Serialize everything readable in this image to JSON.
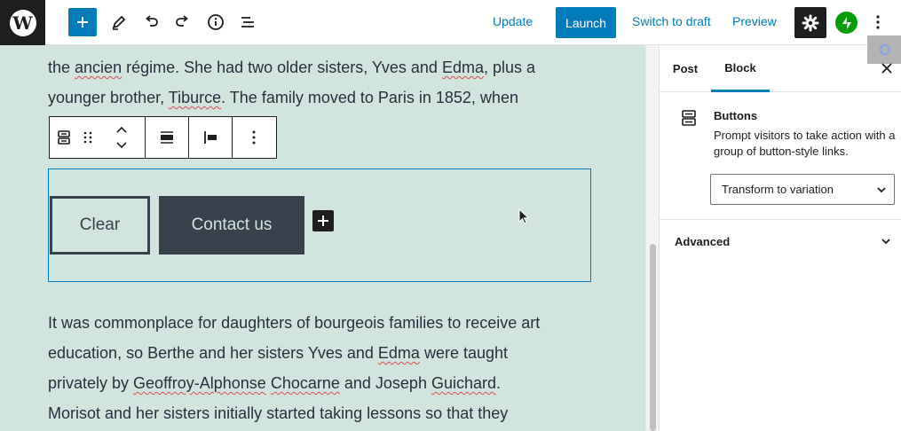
{
  "toolbar": {
    "update_label": "Update",
    "launch_label": "Launch",
    "switch_draft_label": "Switch to draft",
    "preview_label": "Preview",
    "logo_letter": "W"
  },
  "content": {
    "para1": [
      [
        {
          "t": "the "
        },
        {
          "t": "ancien",
          "s": true
        },
        {
          "t": " régime. She had two older sisters, Yves and "
        },
        {
          "t": "Edma",
          "s": true
        },
        {
          "t": ", plus a"
        }
      ],
      [
        {
          "t": "younger brother, "
        },
        {
          "t": "Tiburce",
          "s": true
        },
        {
          "t": ". The family moved to Paris in 1852, when"
        }
      ]
    ],
    "para2": [
      [
        {
          "t": "It was commonplace for daughters of bourgeois families to receive art"
        }
      ],
      [
        {
          "t": "education, so Berthe and her sisters Yves and "
        },
        {
          "t": "Edma",
          "s": true
        },
        {
          "t": " were taught"
        }
      ],
      [
        {
          "t": "privately by "
        },
        {
          "t": "Geoffroy-Alphonse",
          "s": true
        },
        {
          "t": " "
        },
        {
          "t": "Chocarne",
          "s": true
        },
        {
          "t": " and Joseph "
        },
        {
          "t": "Guichard",
          "s": true
        },
        {
          "t": "."
        }
      ],
      [
        {
          "t": "Morisot and her sisters initially started taking lessons so that they"
        }
      ]
    ]
  },
  "buttons_block": {
    "clear_label": "Clear",
    "contact_label": "Contact us"
  },
  "sidebar": {
    "tabs": [
      {
        "label": "Post"
      },
      {
        "label": "Block"
      }
    ],
    "active_tab": "Block",
    "block_title": "Buttons",
    "block_description": "Prompt visitors to take action with a group of button-style links.",
    "transform_select": "Transform to variation",
    "advanced_label": "Advanced"
  },
  "colors": {
    "accent": "#007cba",
    "canvas_bg": "#d1e4dd",
    "button_dark": "#39414d",
    "jetpack_green": "#069e08"
  }
}
